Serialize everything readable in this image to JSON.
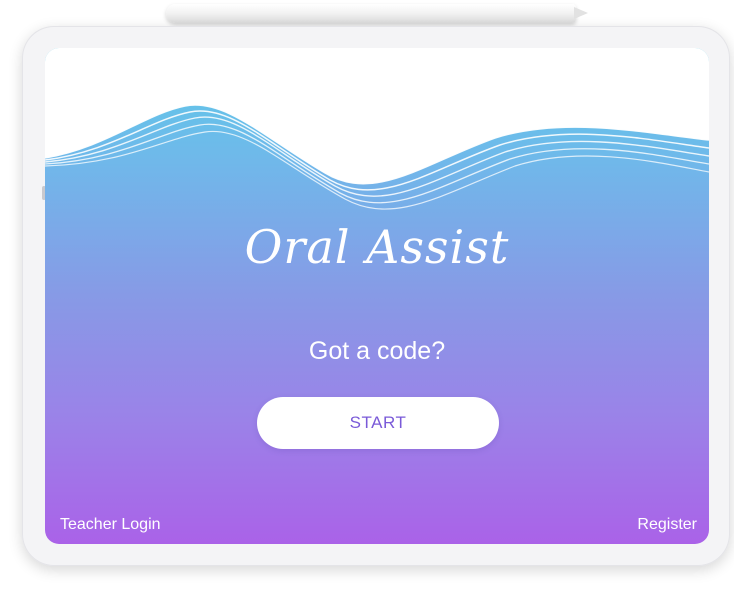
{
  "app": {
    "title": "Oral Assist",
    "prompt": "Got a code?",
    "start_label": "START",
    "teacher_login_label": "Teacher Login",
    "register_label": "Register"
  },
  "colors": {
    "gradient_top": "#5ccae8",
    "gradient_bottom": "#aa62e8",
    "button_text": "#7a5ad8",
    "text": "#ffffff"
  }
}
